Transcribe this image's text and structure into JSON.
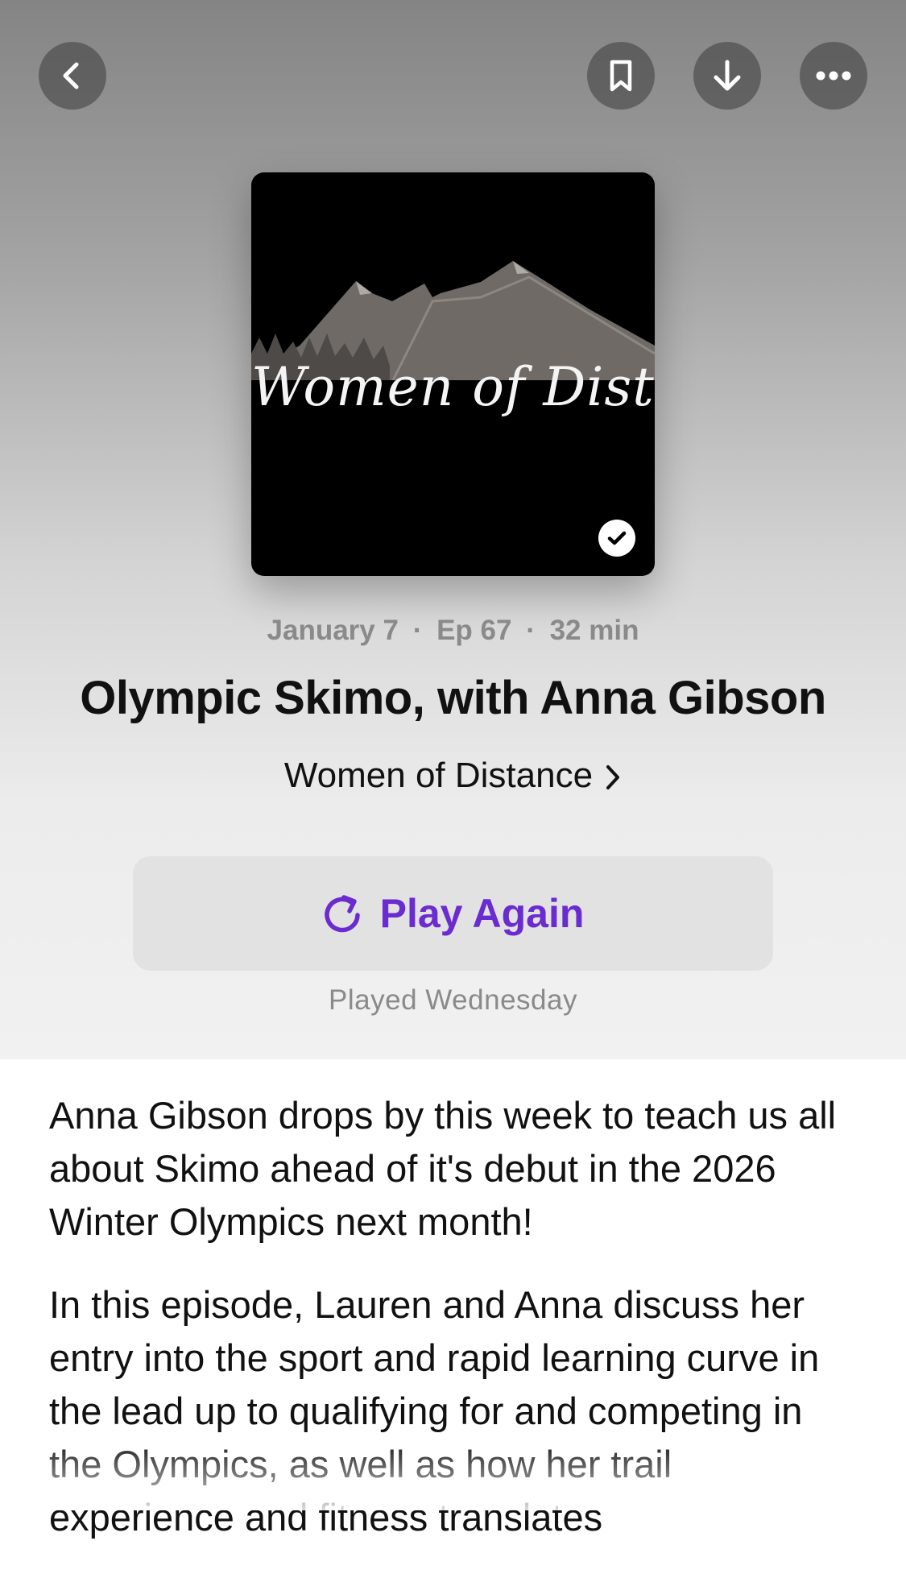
{
  "nav": {
    "back_icon": "chevron-left-icon",
    "bookmark_icon": "bookmark-icon",
    "download_icon": "arrow-down-icon",
    "more_icon": "ellipsis-icon"
  },
  "artwork": {
    "text": "Women of Distance",
    "played_badge_icon": "checkmark-circle-icon"
  },
  "episode": {
    "date": "January 7",
    "episode_number": "Ep 67",
    "duration": "32 min",
    "separator": "·",
    "title": "Olympic Skimo, with Anna Gibson",
    "show_name": "Women of Distance"
  },
  "play_button": {
    "label": "Play Again",
    "icon": "replay-icon",
    "color": "#6a2bd0"
  },
  "played_status": "Played Wednesday",
  "description": {
    "paragraph_1": "Anna Gibson drops by this week to teach us all about Skimo ahead of it's debut in the 2026 Winter Olympics next month!",
    "paragraph_2": "In this episode, Lauren and Anna discuss her entry into the sport and rapid learning curve in the lead up to qualifying for and competing in the Olympics, as well as how her trail experience and fitness translates"
  }
}
